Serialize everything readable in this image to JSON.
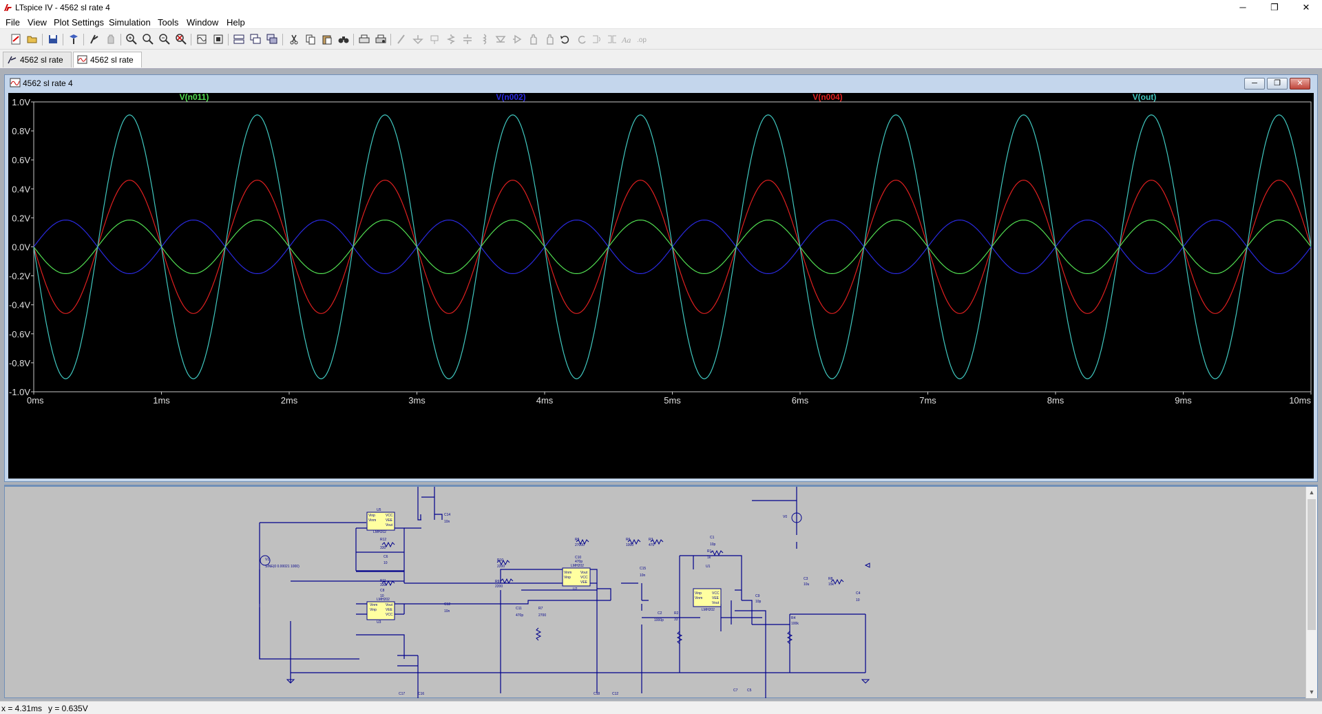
{
  "window": {
    "title": "LTspice IV - 4562  sl rate 4",
    "minimize_glyph": "─",
    "maximize_glyph": "❐",
    "close_glyph": "✕"
  },
  "menu": [
    "File",
    "View",
    "Plot Settings",
    "Simulation",
    "Tools",
    "Window",
    "Help"
  ],
  "toolbar_icons": [
    "new-schematic-icon",
    "open-icon",
    "save-icon",
    "control-panel-icon",
    "run-icon",
    "halt-icon",
    "zoom-in-icon",
    "zoom-full-icon",
    "zoom-out-icon",
    "zoom-cancel-icon",
    "autorange-icon",
    "fit-icon",
    "tile-horizontal-icon",
    "cascade-icon",
    "tile-vertical-icon",
    "cut-icon",
    "copy-icon",
    "paste-icon",
    "find-icon",
    "print-icon",
    "print-preview-icon",
    "wire-icon",
    "ground-icon",
    "label-icon",
    "resistor-icon",
    "capacitor-icon",
    "inductor-icon",
    "diode-icon",
    "component-icon",
    "move-icon",
    "drag-icon",
    "undo-icon",
    "redo-icon",
    "rotate-icon",
    "mirror-icon",
    "text-icon",
    "spice-directive-icon"
  ],
  "tabs": [
    {
      "label": "4562  sl rate 4",
      "icon": "schematic-icon"
    },
    {
      "label": "4562  sl rate 4",
      "icon": "waveform-icon"
    }
  ],
  "plot_window": {
    "title": "4562  sl rate 4",
    "buttons": {
      "minimize": "─",
      "restore": "❐",
      "close": "✕"
    }
  },
  "schematic_window": {
    "labels": {
      "u5": "U5",
      "u5p": "LMH202",
      "vcc": "VCC",
      "vee": "VEE",
      "vinp": "Vinp",
      "vinm": "Vinm",
      "vout": "Vout",
      "c14": "C14",
      "c14v": "10n",
      "r12": "R12",
      "r12v": "330",
      "c6": "C6",
      "c6v": "10",
      "v1": "V1",
      "v1v": "SINE(0 0.00021 1000)",
      "r11": "R11",
      "r11v": "330",
      "c8": "C8",
      "c8v": "10",
      "u3": "U3",
      "c13": "C13",
      "c13v": "10n",
      "r10": "R10",
      "r10v": "2200",
      "r9": "R9",
      "r9v": "2200",
      "r5": "R5",
      "r5v": "27000",
      "c10": "C10",
      "c10v": "470p",
      "r6": "R6",
      "r6v": "1000",
      "r3": "R3",
      "r3v": "470",
      "u2": "U2",
      "c15": "C15",
      "c15v": "10n",
      "c11": "C11",
      "c11v": "470p",
      "r7": "R7",
      "r7v": "2700",
      "c2": "C2",
      "c2v": "1000p",
      "r2": "R2",
      "r2v": "33",
      "c1": "C1",
      "c1v": "10p",
      "r1": "R1",
      "r1v": "1k",
      "u1": "U1",
      "c9": "C9",
      "c9v": "10p",
      "c3": "C3",
      "c3v": "10u",
      "r8": "R8",
      "r8v": "15k",
      "r4": "R4",
      "r4v": "100k",
      "c4": "C4",
      "c4v": "10",
      "v0": "V0",
      "c17": "C17",
      "c16": "C16",
      "c18": "C18",
      "c12": "C12",
      "c7": "C7",
      "c5": "C5",
      "c12v": "10n"
    }
  },
  "status": {
    "x": "x = 4.31ms",
    "y": "y = 0.635V"
  },
  "chart_data": {
    "type": "line",
    "title": "",
    "xlabel": "",
    "ylabel": "",
    "xlim": [
      0,
      10
    ],
    "ylim": [
      -1.0,
      1.0
    ],
    "x_ticks": [
      "0ms",
      "1ms",
      "2ms",
      "3ms",
      "4ms",
      "5ms",
      "6ms",
      "7ms",
      "8ms",
      "9ms",
      "10ms"
    ],
    "y_ticks": [
      "1.0V",
      "0.8V",
      "0.6V",
      "0.4V",
      "0.2V",
      "0.0V",
      "-0.2V",
      "-0.4V",
      "-0.6V",
      "-0.8V",
      "-1.0V"
    ],
    "frequency_hz": 1000,
    "series": [
      {
        "name": "V(n011)",
        "color": "#52e052",
        "amplitude": 0.185,
        "phase_deg": 180,
        "shape": "sine"
      },
      {
        "name": "V(n002)",
        "color": "#2a2ae0",
        "amplitude": 0.185,
        "phase_deg": 0,
        "shape": "sine"
      },
      {
        "name": "V(n004)",
        "color": "#e02020",
        "amplitude": 0.46,
        "phase_deg": 180,
        "shape": "sine"
      },
      {
        "name": "V(out)",
        "color": "#40c8c0",
        "amplitude": 0.91,
        "phase_deg": 180,
        "shape": "sine"
      }
    ]
  }
}
